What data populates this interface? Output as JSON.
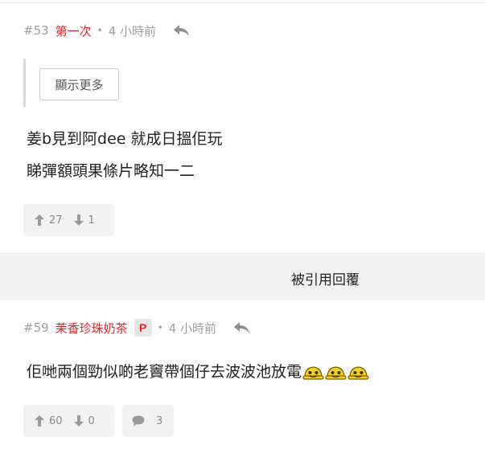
{
  "posts": [
    {
      "floor": "#53",
      "user": "第一次",
      "dot": "•",
      "time": "4 小時前",
      "show_more_label": "顯示更多",
      "content_lines": [
        "姜b見到阿dee 就成日搵佢玩",
        "睇彈額頭果條片略知一二"
      ],
      "upvotes": "27",
      "downvotes": "1"
    },
    {
      "floor": "#59",
      "user": "茉香珍珠奶茶",
      "badge": "P",
      "dot": "•",
      "time": "4 小時前",
      "content_line": "佢哋兩個勁似啲老竇帶個仔去波波池放電",
      "emoji_count": 3,
      "upvotes": "60",
      "downvotes": "0",
      "replies": "3"
    }
  ],
  "quote_bar": {
    "label": "被引用回覆"
  },
  "colors": {
    "accent": "#e0252c",
    "muted": "#9e9e9e",
    "panel": "#f2f2f2"
  },
  "icons": [
    "reply-icon",
    "upvote-icon",
    "downvote-icon",
    "comment-icon",
    "emoji-icon"
  ]
}
